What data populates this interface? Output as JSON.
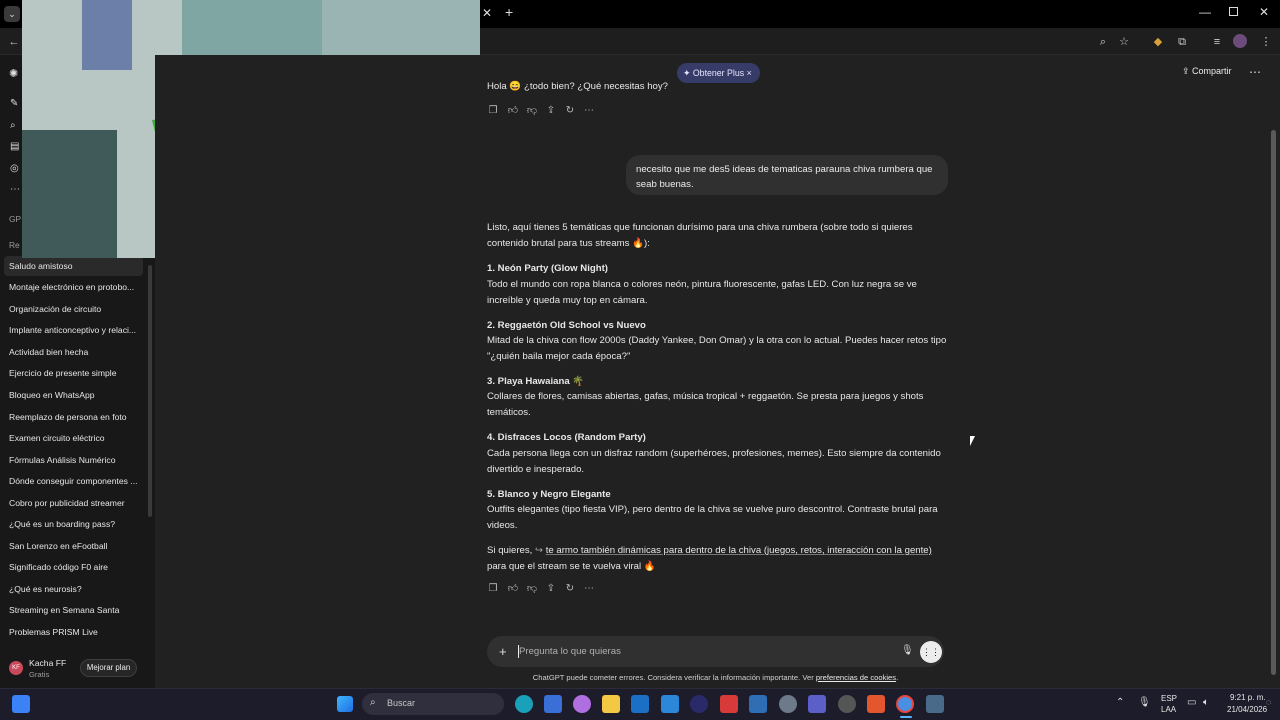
{
  "browser": {
    "new_tab_icon": "plus-icon",
    "close_tab_icon": "close-icon",
    "window_controls": [
      "minimize-icon",
      "restore-icon",
      "close-icon"
    ]
  },
  "header": {
    "upgrade_pill": "Obtener Plus",
    "share_label": "Compartir"
  },
  "sidebar": {
    "section_gpts": "GP",
    "section_recent": "Re",
    "items": [
      "Saludo amistoso",
      "Montaje electrónico en protobo...",
      "Organización de circuito",
      "Implante anticonceptivo y relaci...",
      "Actividad bien hecha",
      "Ejercicio de presente simple",
      "Bloqueo en WhatsApp",
      "Reemplazo de persona en foto",
      "Examen circuito eléctrico",
      "Fórmulas Análisis Numérico",
      "Dónde conseguir componentes ...",
      "Cobro por publicidad streamer",
      "¿Qué es un boarding pass?",
      "San Lorenzo en eFootball",
      "Significado código F0 aire",
      "¿Qué es neurosis?",
      "Streaming en Semana Santa",
      "Problemas PRISM Live"
    ],
    "user": {
      "initials": "KF",
      "name": "Kacha FF",
      "plan": "Gratis",
      "upgrade_button": "Mejorar plan"
    }
  },
  "chat": {
    "greeting": "Hola 😄 ¿todo bien? ¿Qué necesitas hoy?",
    "user_message": "necesito que me des5 ideas de tematicas parauna chiva rumbera que seab buenas.",
    "intro": "Listo, aquí tienes 5 temáticas que funcionan durísimo para una chiva rumbera (sobre todo si quieres contenido brutal para tus streams 🔥):",
    "ideas": [
      {
        "title": "1. Neón Party (Glow Night)",
        "body": "Todo el mundo con ropa blanca o colores neón, pintura fluorescente, gafas LED. Con luz negra se ve increíble y queda muy top en cámara."
      },
      {
        "title": "2. Reggaetón Old School vs Nuevo",
        "body": "Mitad de la chiva con flow 2000s (Daddy Yankee, Don Omar) y la otra con lo actual. Puedes hacer retos tipo \"¿quién baila mejor cada época?\""
      },
      {
        "title": "3. Playa Hawaiana 🌴",
        "body": "Collares de flores, camisas abiertas, gafas, música tropical + reggaetón. Se presta para juegos y shots temáticos."
      },
      {
        "title": "4. Disfraces Locos (Random Party)",
        "body": "Cada persona llega con un disfraz random (superhéroes, profesiones, memes). Esto siempre da contenido divertido e inesperado."
      },
      {
        "title": "5. Blanco y Negro Elegante",
        "body": "Outfits elegantes (tipo fiesta VIP), pero dentro de la chiva se vuelve puro descontrol. Contraste brutal para videos."
      }
    ],
    "outro_prefix": "Si quieres, ",
    "outro_link": "te armo también dinámicas para dentro de la chiva (juegos, retos, interacción con la gente)",
    "outro_suffix": " para que el stream se te vuelva viral 🔥",
    "action_icons": [
      "copy-icon",
      "thumbs-up-icon",
      "thumbs-down-icon",
      "share-icon",
      "regenerate-icon",
      "more-icon"
    ]
  },
  "composer": {
    "placeholder": "Pregunta lo que quieras",
    "disclaimer_prefix": "ChatGPT puede cometer errores. Considera verificar la información importante. Ver ",
    "disclaimer_link": "preferencias de cookies",
    "disclaimer_suffix": "."
  },
  "taskbar": {
    "search_label": "Buscar",
    "language": "ESP",
    "layout": "LAA",
    "time": "9:21 p. m.",
    "date": "21/04/2026"
  },
  "colors": {
    "background": "#212121",
    "sidebar": "#181818",
    "bubble": "#303030",
    "accent_pill": "#373b68",
    "taskbar": "#1c1c2a"
  }
}
